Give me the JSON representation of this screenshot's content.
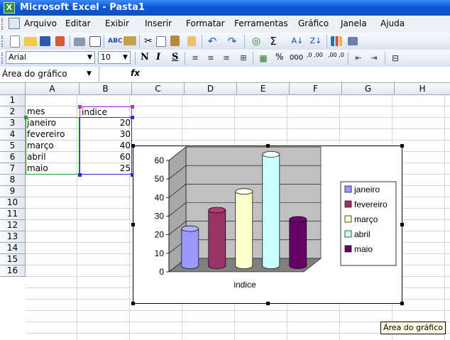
{
  "window": {
    "title": "Microsoft Excel - Pasta1",
    "app_icon": "excel-icon"
  },
  "menu": {
    "items": [
      "Arquivo",
      "Editar",
      "Exibir",
      "Inserir",
      "Formatar",
      "Ferramentas",
      "Gráfico",
      "Janela",
      "Ajuda"
    ]
  },
  "toolbar": {
    "icons": [
      "new-icon",
      "open-icon",
      "save-icon",
      "permission-icon",
      "print-icon",
      "print-preview-icon",
      "spelling-icon",
      "research-icon",
      "cut-icon",
      "copy-icon",
      "paste-icon",
      "format-painter-icon",
      "undo-icon",
      "redo-icon",
      "hyperlink-icon",
      "autosum-icon",
      "sort-ascending-icon",
      "sort-descending-icon",
      "chart-wizard-icon",
      "drawing-icon"
    ],
    "autosum_label": "Σ"
  },
  "format": {
    "font": "Arial",
    "size": "10",
    "bold": "N",
    "italic": "I",
    "underline": "S",
    "percent": "%",
    "thousands": "000",
    "dec_inc": ",0 ,00",
    "dec_dec": ",00 ,0"
  },
  "formula": {
    "name_box": "Área do gráfico",
    "fx": "fx"
  },
  "columns": [
    "A",
    "B",
    "C",
    "D",
    "E",
    "F",
    "G",
    "H"
  ],
  "rows": [
    "1",
    "2",
    "3",
    "4",
    "5",
    "6",
    "7",
    "8",
    "9",
    "10",
    "11",
    "12",
    "13",
    "14",
    "15",
    "16"
  ],
  "cells": {
    "A2": "mes",
    "B2": "indice",
    "A3": "janeiro",
    "B3": "20",
    "A4": "fevereiro",
    "B4": "30",
    "A5": "março",
    "B5": "40",
    "A6": "abril",
    "B6": "60",
    "A7": "maio",
    "B7": "25"
  },
  "tooltip": "Área do gráfico",
  "colors": {
    "title_bar": "#0a58d6",
    "grid_line": "#d0d7e5",
    "selection_green": "#2d9a2d",
    "selection_blue": "#2a2adf",
    "selection_magenta": "#c030c0"
  },
  "chart_data": {
    "type": "bar",
    "categories": [
      "janeiro",
      "fevereiro",
      "março",
      "abril",
      "maio"
    ],
    "series": [
      {
        "name": "indice",
        "values": [
          20,
          30,
          40,
          60,
          25
        ]
      }
    ],
    "bar_colors": [
      "#9999ff",
      "#993366",
      "#ffffcc",
      "#ccffff",
      "#660066"
    ],
    "xlabel": "indice",
    "ylabel": "",
    "ylim": [
      0,
      60
    ],
    "yticks": [
      "0",
      "10",
      "20",
      "30",
      "40",
      "50",
      "60"
    ],
    "legend": "right",
    "grid": true,
    "style": "3d-column"
  }
}
